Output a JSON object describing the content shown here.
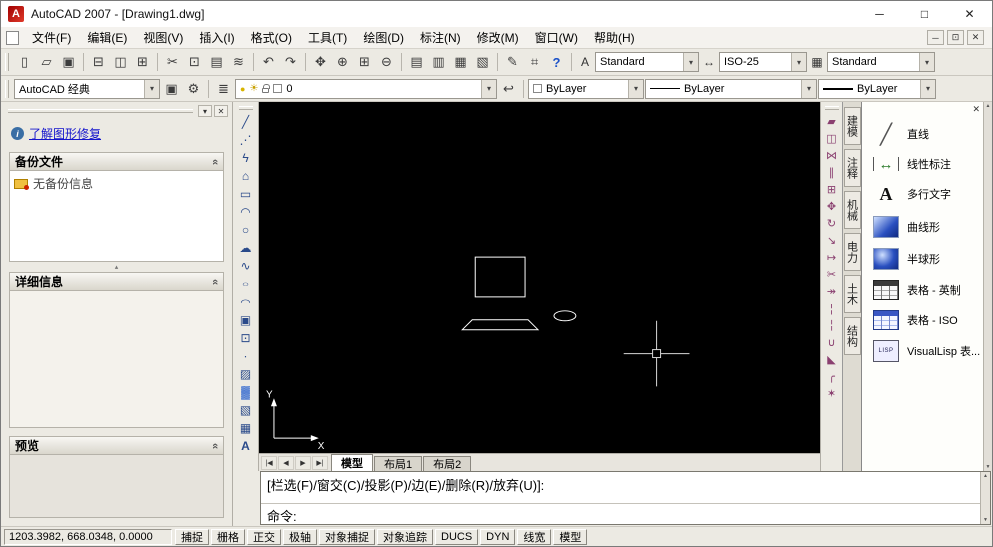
{
  "window": {
    "title": "AutoCAD 2007 - [Drawing1.dwg]"
  },
  "menu": {
    "items": [
      "文件(F)",
      "编辑(E)",
      "视图(V)",
      "插入(I)",
      "格式(O)",
      "工具(T)",
      "绘图(D)",
      "标注(N)",
      "修改(M)",
      "窗口(W)",
      "帮助(H)"
    ]
  },
  "toolbar_standard": {
    "icons": [
      "new",
      "open",
      "save",
      "sep",
      "plot",
      "plot-preview",
      "publish",
      "sep",
      "cut",
      "copy",
      "paste",
      "match-properties",
      "sep",
      "undo",
      "redo",
      "sep",
      "pan",
      "zoom-realtime",
      "zoom-window",
      "zoom-previous",
      "sep",
      "properties",
      "designcenter",
      "tool-palettes",
      "sheetset-manager",
      "sep",
      "markup",
      "quickcalc",
      "help"
    ],
    "text_style": "Standard",
    "dim_style": "ISO-25",
    "table_style": "Standard"
  },
  "toolbar_properties": {
    "workspace": "AutoCAD 经典",
    "left_icons": [
      "save-workspace",
      "workspace-settings"
    ],
    "layer_icons": [
      "layer-properties-manager"
    ],
    "layer_name": "0",
    "after_layer_icons": [
      "layer-previous"
    ],
    "color": "ByLayer",
    "linetype": "ByLayer",
    "lineweight": "ByLayer"
  },
  "recovery_panel": {
    "help_link": "了解图形修复",
    "backup": {
      "title": "备份文件",
      "empty_item": "无备份信息"
    },
    "details": {
      "title": "详细信息"
    },
    "preview": {
      "title": "预览"
    }
  },
  "draw_toolbar": {
    "icons": [
      "line",
      "construction-line",
      "polyline",
      "polygon",
      "rectangle",
      "arc",
      "circle",
      "revision-cloud",
      "spline",
      "ellipse",
      "ellipse-arc",
      "insert-block",
      "make-block",
      "point",
      "hatch",
      "gradient",
      "region",
      "table",
      "multiline-text"
    ]
  },
  "modify_toolbar": {
    "icons": [
      "erase",
      "copy-object",
      "mirror",
      "offset",
      "array",
      "move",
      "rotate",
      "scale",
      "stretch",
      "trim",
      "extend",
      "break-at-point",
      "break",
      "join",
      "chamfer",
      "fillet",
      "explode"
    ]
  },
  "canvas": {
    "ucs": {
      "x_label": "X",
      "y_label": "Y"
    }
  },
  "layout_tabs": {
    "tabs": [
      "模型",
      "布局1",
      "布局2"
    ],
    "active_index": 0
  },
  "palette": {
    "tabs": [
      "建模",
      "注释",
      "机械",
      "电力",
      "土木",
      "结构"
    ],
    "items": [
      {
        "label": "直线",
        "icon": "line-icon"
      },
      {
        "label": "线性标注",
        "icon": "dimension-icon"
      },
      {
        "label": "多行文字",
        "icon": "mtext-icon"
      },
      {
        "label": "曲线形",
        "icon": "surface-image-icon"
      },
      {
        "label": "半球形",
        "icon": "sphere-image-icon"
      },
      {
        "label": "表格 - 英制",
        "icon": "table-imperial-icon"
      },
      {
        "label": "表格 - ISO",
        "icon": "table-iso-icon"
      },
      {
        "label": "VisualLisp 表...",
        "icon": "lisp-icon"
      }
    ]
  },
  "command": {
    "history_line": "[栏选(F)/窗交(C)/投影(P)/边(E)/删除(R)/放弃(U)]:",
    "input_line": "命令:"
  },
  "statusbar": {
    "coordinates": "1203.3982, 668.0348, 0.0000",
    "toggles": [
      "捕捉",
      "栅格",
      "正交",
      "极轴",
      "对象捕捉",
      "对象追踪",
      "DUCS",
      "DYN",
      "线宽",
      "模型"
    ]
  }
}
